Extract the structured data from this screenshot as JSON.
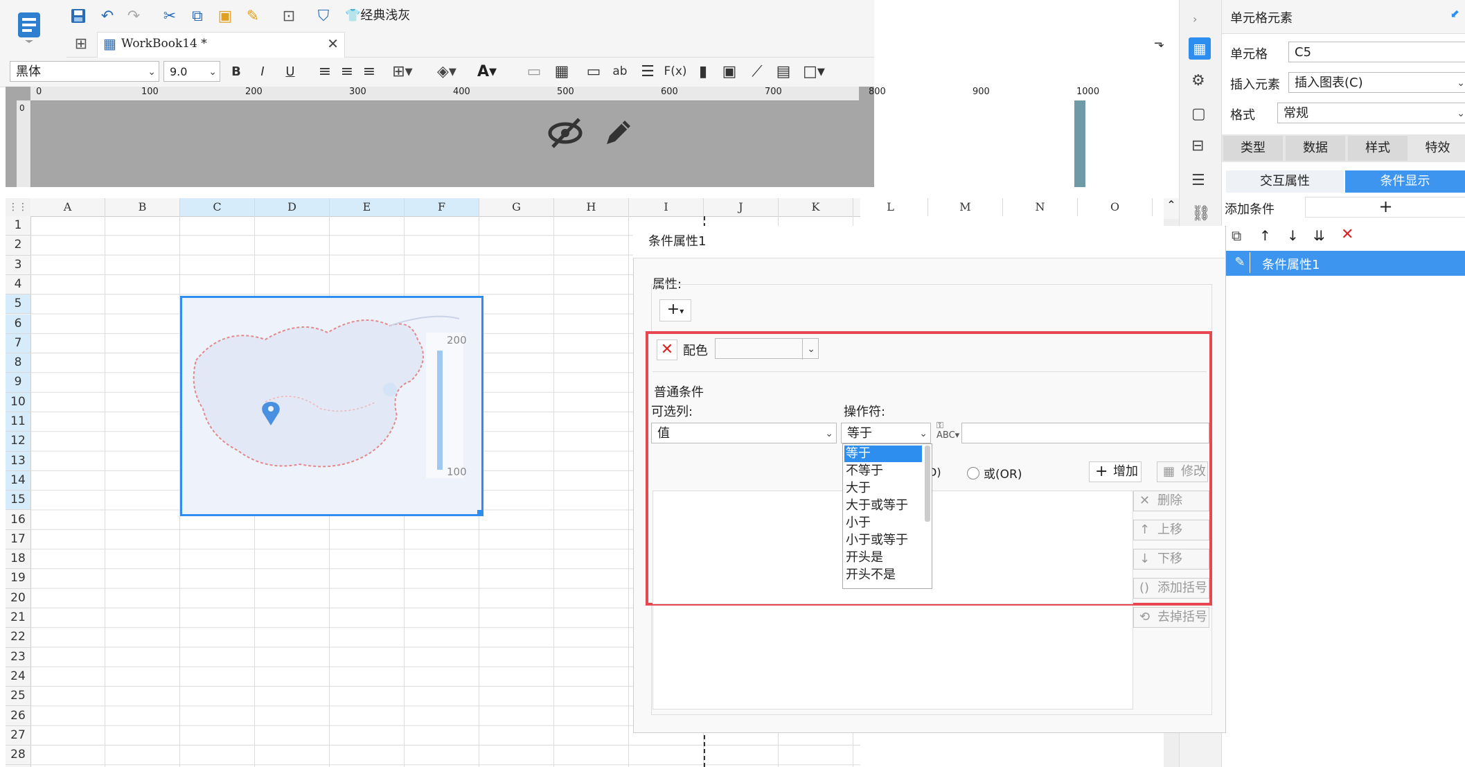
{
  "app": {
    "logo": "app-logo-icon"
  },
  "toolbar": {
    "theme_label": "经典浅灰",
    "font_name": "黑体",
    "font_size": "9.0"
  },
  "tab": {
    "name": "WorkBook14 *"
  },
  "ruler": {
    "marks": [
      "0",
      "100",
      "200",
      "300",
      "400",
      "500",
      "600",
      "700",
      "800",
      "900",
      "1000"
    ],
    "v_mark": "0"
  },
  "sheet": {
    "columns": [
      "A",
      "B",
      "C",
      "D",
      "E",
      "F",
      "G",
      "H",
      "I",
      "J",
      "K",
      "L",
      "M",
      "N",
      "O"
    ],
    "rows": [
      "1",
      "2",
      "3",
      "4",
      "5",
      "6",
      "7",
      "8",
      "9",
      "10",
      "11",
      "12",
      "13",
      "14",
      "15",
      "16",
      "17",
      "18",
      "19",
      "20",
      "21",
      "22",
      "23",
      "24",
      "25",
      "26",
      "27",
      "28"
    ],
    "map_legend_max": "200",
    "map_legend_min": "100"
  },
  "dialog": {
    "title": "条件属性1",
    "attr_label": "属性:",
    "color_label": "配色",
    "normal_cond_label": "普通条件",
    "optional_col_label": "可选列:",
    "operator_label": "操作符:",
    "col_value": "值",
    "op_value": "等于",
    "op_options": [
      "等于",
      "不等于",
      "大于",
      "大于或等于",
      "小于",
      "小于或等于",
      "开头是",
      "开头不是"
    ],
    "and_partial": "D)",
    "or_label": "或(OR)",
    "add_btn": "增加",
    "edit_btn": "修改",
    "del_btn": "删除",
    "up_btn": "上移",
    "down_btn": "下移",
    "add_paren_btn": "添加括号",
    "remove_paren_btn": "去掉括号"
  },
  "right_panel": {
    "title": "单元格元素",
    "cell_label": "单元格",
    "cell_value": "C5",
    "insert_label": "插入元素",
    "insert_value": "插入图表(C)",
    "format_label": "格式",
    "format_value": "常规",
    "tabs": [
      "类型",
      "数据",
      "样式",
      "特效"
    ],
    "subtabs": [
      "交互属性",
      "条件显示"
    ],
    "add_cond_label": "添加条件",
    "cond_item": "条件属性1"
  },
  "colors": {
    "accent": "#2d8ef0",
    "highlight_border": "#e8474f",
    "selected_tab": "#3d95f0"
  }
}
